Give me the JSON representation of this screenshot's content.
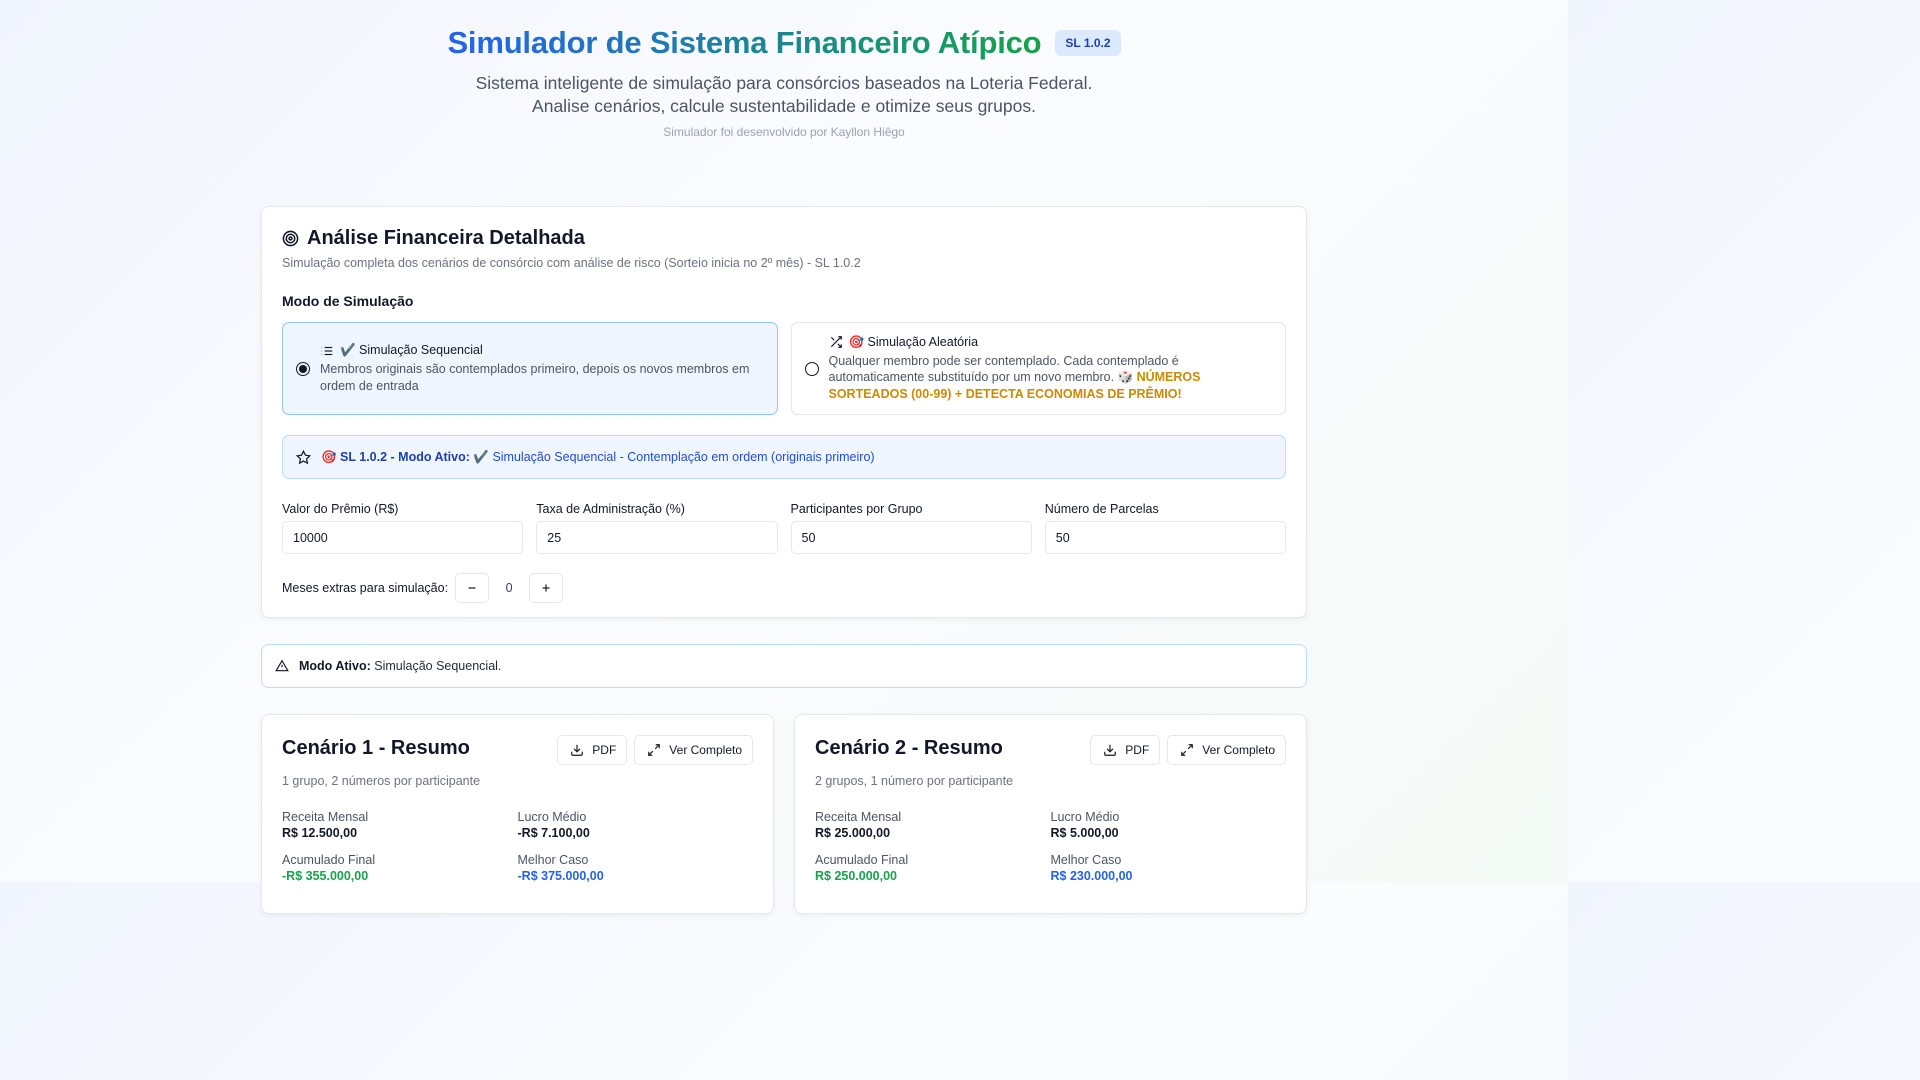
{
  "header": {
    "title": "Simulador de Sistema Financeiro Atípico",
    "version": "SL 1.0.2",
    "subtitle_line1": "Sistema inteligente de simulação para consórcios baseados na Loteria Federal.",
    "subtitle_line2": "Analise cenários, calcule sustentabilidade e otimize seus grupos.",
    "credit": "Simulador foi desenvolvido por Kayllon Hiêgo"
  },
  "analysis": {
    "title": "Análise Financeira Detalhada",
    "subtitle": "Simulação completa dos cenários de consórcio com análise de risco (Sorteio inicia no 2º mês) - SL 1.0.2",
    "mode_label": "Modo de Simulação",
    "modes": [
      {
        "title": "✔️ Simulação Sequencial",
        "desc": "Membros originais são contemplados primeiro, depois os novos membros em ordem de entrada",
        "selected": true
      },
      {
        "title": "🎯 Simulação Aleatória",
        "desc": "Qualquer membro pode ser contemplado. Cada contemplado é automaticamente substituído por um novo membro. 🎲",
        "warn": "NÚMEROS SORTEADOS (00-99) + DETECTA ECONOMIAS DE PRÊMIO!",
        "selected": false
      }
    ],
    "active_banner": {
      "strong": "🎯 SL 1.0.2 - Modo Ativo:",
      "text": "✔️ Simulação Sequencial - Contemplação em ordem (originais primeiro)"
    },
    "fields": [
      {
        "label": "Valor do Prêmio (R$)",
        "value": "10000"
      },
      {
        "label": "Taxa de Administração (%)",
        "value": "25"
      },
      {
        "label": "Participantes por Grupo",
        "value": "50"
      },
      {
        "label": "Número de Parcelas",
        "value": "50"
      }
    ],
    "extra_months": {
      "label": "Meses extras para simulação:",
      "value": "0"
    }
  },
  "alert": {
    "strong": "Modo Ativo:",
    "text": "Simulação Sequencial."
  },
  "scenarios": [
    {
      "title": "Cenário 1 - Resumo",
      "subtitle": "1 grupo, 2 números por participante",
      "pdf_label": "PDF",
      "full_label": "Ver Completo",
      "metrics": {
        "receita_label": "Receita Mensal",
        "receita": "R$ 12.500,00",
        "lucro_label": "Lucro Médio",
        "lucro": "-R$ 7.100,00",
        "acumulado_label": "Acumulado Final",
        "acumulado": "-R$ 355.000,00",
        "melhor_label": "Melhor Caso",
        "melhor": "-R$ 375.000,00"
      }
    },
    {
      "title": "Cenário 2 - Resumo",
      "subtitle": "2 grupos, 1 número por participante",
      "pdf_label": "PDF",
      "full_label": "Ver Completo",
      "metrics": {
        "receita_label": "Receita Mensal",
        "receita": "R$ 25.000,00",
        "lucro_label": "Lucro Médio",
        "lucro": "R$ 5.000,00",
        "acumulado_label": "Acumulado Final",
        "acumulado": "R$ 250.000,00",
        "melhor_label": "Melhor Caso",
        "melhor": "R$ 230.000,00"
      }
    }
  ]
}
